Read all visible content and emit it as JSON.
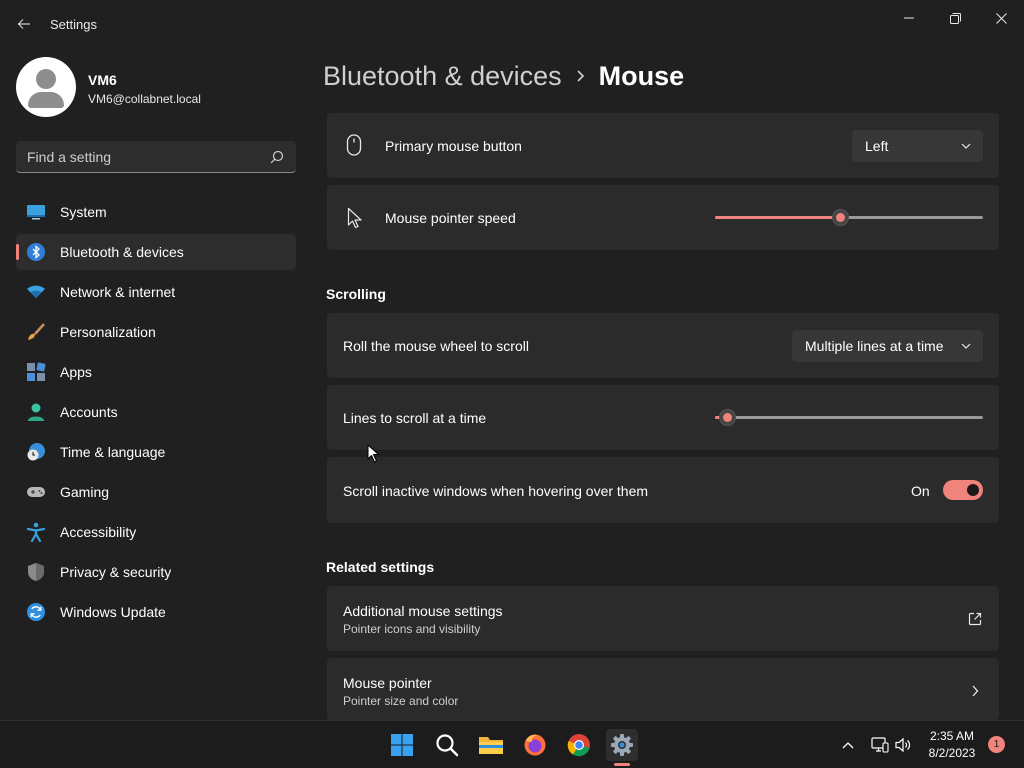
{
  "window": {
    "title": "Settings"
  },
  "user": {
    "name": "VM6",
    "email": "VM6@collabnet.local"
  },
  "search": {
    "placeholder": "Find a setting"
  },
  "sidebar": {
    "items": [
      {
        "label": "System",
        "icon": "system-icon"
      },
      {
        "label": "Bluetooth & devices",
        "icon": "bluetooth-icon",
        "active": true
      },
      {
        "label": "Network & internet",
        "icon": "wifi-icon"
      },
      {
        "label": "Personalization",
        "icon": "brush-icon"
      },
      {
        "label": "Apps",
        "icon": "apps-icon"
      },
      {
        "label": "Accounts",
        "icon": "account-icon"
      },
      {
        "label": "Time & language",
        "icon": "globe-clock-icon"
      },
      {
        "label": "Gaming",
        "icon": "gamepad-icon"
      },
      {
        "label": "Accessibility",
        "icon": "accessibility-icon"
      },
      {
        "label": "Privacy & security",
        "icon": "shield-icon"
      },
      {
        "label": "Windows Update",
        "icon": "update-icon"
      }
    ]
  },
  "breadcrumb": {
    "parent": "Bluetooth & devices",
    "current": "Mouse"
  },
  "settings": {
    "primary_button": {
      "label": "Primary mouse button",
      "value": "Left"
    },
    "pointer_speed": {
      "label": "Mouse pointer speed",
      "level": 0.47
    },
    "scrolling_header": "Scrolling",
    "roll_wheel": {
      "label": "Roll the mouse wheel to scroll",
      "value": "Multiple lines at a time"
    },
    "lines_to_scroll": {
      "label": "Lines to scroll at a time",
      "level": 0.05
    },
    "scroll_inactive": {
      "label": "Scroll inactive windows when hovering over them",
      "state": "On"
    },
    "related_header": "Related settings",
    "additional": {
      "label": "Additional mouse settings",
      "sub": "Pointer icons and visibility"
    },
    "mouse_pointer": {
      "label": "Mouse pointer",
      "sub": "Pointer size and color"
    }
  },
  "taskbar": {
    "apps": [
      "windows-start-icon",
      "search-icon",
      "file-explorer-icon",
      "firefox-icon",
      "chrome-icon",
      "settings-icon"
    ],
    "time": "2:35 AM",
    "date": "8/2/2023",
    "notifications": "1"
  },
  "colors": {
    "accent": "#f0837c",
    "background": "#202020",
    "card": "#2b2b2b"
  }
}
